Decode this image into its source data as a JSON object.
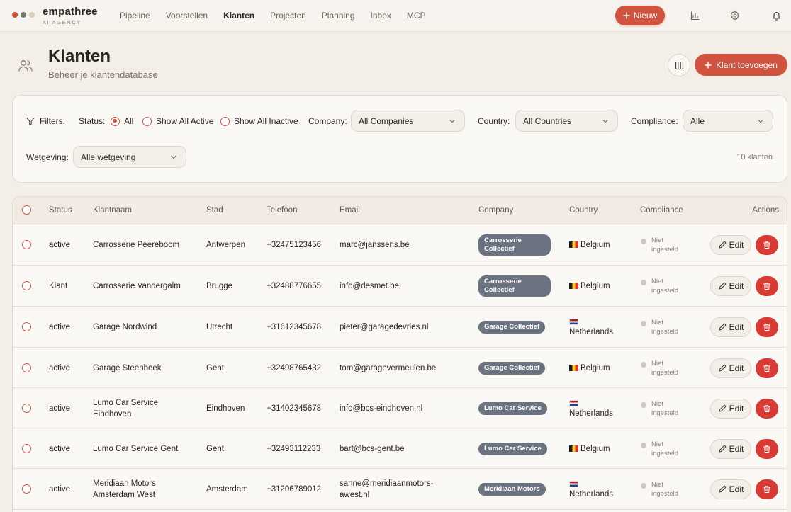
{
  "brand": {
    "name": "empathree",
    "tagline": "AI AGENCY",
    "dot_colors": [
      "#d05340",
      "#6f7a6b",
      "#d8cdb9"
    ]
  },
  "nav": [
    {
      "label": "Pipeline",
      "active": false
    },
    {
      "label": "Voorstellen",
      "active": false
    },
    {
      "label": "Klanten",
      "active": true
    },
    {
      "label": "Projecten",
      "active": false
    },
    {
      "label": "Planning",
      "active": false
    },
    {
      "label": "Inbox",
      "active": false
    },
    {
      "label": "MCP",
      "active": false
    }
  ],
  "top_actions": {
    "new_label": "Nieuw",
    "icons": [
      "chart-icon",
      "gear-icon",
      "bell-icon"
    ]
  },
  "page": {
    "title": "Klanten",
    "subtitle": "Beheer je klantendatabase",
    "add_label": "Klant toevoegen"
  },
  "filters": {
    "label": "Filters:",
    "status_label": "Status:",
    "status_options": [
      "All",
      "Show All Active",
      "Show All Inactive"
    ],
    "status_selected": "All",
    "company_label": "Company:",
    "company_value": "All Companies",
    "country_label": "Country:",
    "country_value": "All Countries",
    "compliance_label": "Compliance:",
    "compliance_value": "Alle",
    "wetgeving_label": "Wetgeving:",
    "wetgeving_value": "Alle wetgeving",
    "count": "10 klanten"
  },
  "table": {
    "headers": [
      "Status",
      "Klantnaam",
      "Stad",
      "Telefoon",
      "Email",
      "Company",
      "Country",
      "Compliance",
      "Actions"
    ],
    "edit_label": "Edit",
    "rows": [
      {
        "status": "active",
        "name": [
          "Carrosserie Peereboom"
        ],
        "city": "Antwerpen",
        "phone": "+32475123456",
        "email": [
          "marc@janssens.be"
        ],
        "company": [
          "Carrosserie",
          "Collectief"
        ],
        "country": "Belgium",
        "flag": "be",
        "compliance": [
          "Niet",
          "ingesteld"
        ]
      },
      {
        "status": "Klant",
        "name": [
          "Carrosserie Vandergalm"
        ],
        "city": "Brugge",
        "phone": "+32488776655",
        "email": [
          "info@desmet.be"
        ],
        "company": [
          "Carrosserie",
          "Collectief"
        ],
        "country": "Belgium",
        "flag": "be",
        "compliance": [
          "Niet",
          "ingesteld"
        ]
      },
      {
        "status": "active",
        "name": [
          "Garage Nordwind"
        ],
        "city": "Utrecht",
        "phone": "+31612345678",
        "email": [
          "pieter@garagedevries.nl"
        ],
        "company": [
          "Garage Collectief"
        ],
        "country": "Netherlands",
        "flag": "nl",
        "compliance": [
          "Niet",
          "ingesteld"
        ]
      },
      {
        "status": "active",
        "name": [
          "Garage Steenbeek"
        ],
        "city": "Gent",
        "phone": "+32498765432",
        "email": [
          "tom@garagevermeulen.be"
        ],
        "company": [
          "Garage Collectief"
        ],
        "country": "Belgium",
        "flag": "be",
        "compliance": [
          "Niet",
          "ingesteld"
        ]
      },
      {
        "status": "active",
        "name": [
          "Lumo Car Service",
          "Eindhoven"
        ],
        "city": "Eindhoven",
        "phone": "+31402345678",
        "email": [
          "info@bcs-eindhoven.nl"
        ],
        "company": [
          "Lumo Car Service"
        ],
        "country": "Netherlands",
        "flag": "nl",
        "compliance": [
          "Niet",
          "ingesteld"
        ]
      },
      {
        "status": "active",
        "name": [
          "Lumo Car Service Gent"
        ],
        "city": "Gent",
        "phone": "+32493112233",
        "email": [
          "bart@bcs-gent.be"
        ],
        "company": [
          "Lumo Car Service"
        ],
        "country": "Belgium",
        "flag": "be",
        "compliance": [
          "Niet",
          "ingesteld"
        ]
      },
      {
        "status": "active",
        "name": [
          "Meridiaan Motors",
          "Amsterdam West"
        ],
        "city": "Amsterdam",
        "phone": "+31206789012",
        "email": [
          "sanne@meridiaanmotors-",
          "awest.nl"
        ],
        "company": [
          "Meridiaan Motors"
        ],
        "country": "Netherlands",
        "flag": "nl",
        "compliance": [
          "Niet",
          "ingesteld"
        ]
      }
    ]
  }
}
